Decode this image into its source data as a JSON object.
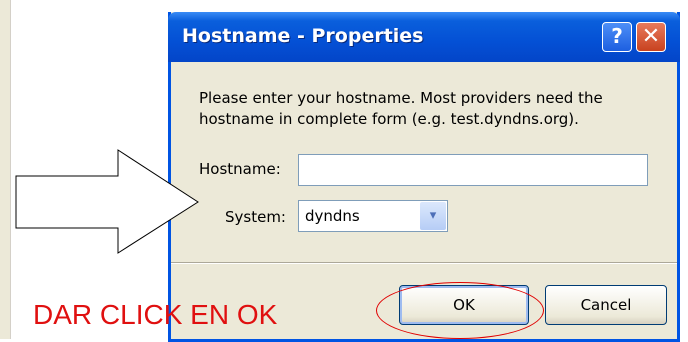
{
  "dialog": {
    "title": "Hostname - Properties",
    "help_label": "?",
    "close_label": "✕",
    "description": "Please enter your hostname. Most providers need the hostname in complete form (e.g. test.dyndns.org).",
    "hostname_label": "Hostname:",
    "hostname_value": "",
    "system_label": "System:",
    "system_value": "dyndns",
    "dropdown_glyph": "▾",
    "ok_label": "OK",
    "cancel_label": "Cancel"
  },
  "annotation": {
    "text": "DAR CLICK EN OK",
    "color": "#e01010"
  },
  "icons": {
    "help": "help-icon",
    "close": "close-icon",
    "dropdown": "chevron-down-icon",
    "arrow": "arrow-right-annotation-icon"
  }
}
